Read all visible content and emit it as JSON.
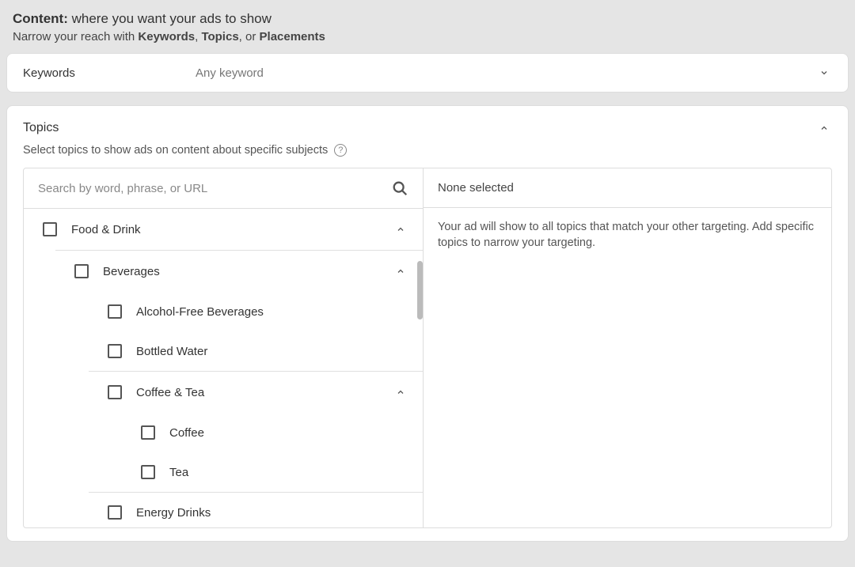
{
  "header": {
    "title_bold": "Content:",
    "title_rest": " where you want your ads to show",
    "subtitle_prefix": "Narrow your reach with ",
    "kw": "Keywords",
    "sep1": ", ",
    "topics": "Topics",
    "sep2": ", or ",
    "placements": "Placements"
  },
  "keywords": {
    "label": "Keywords",
    "value": "Any keyword"
  },
  "topics": {
    "title": "Topics",
    "subtitle": "Select topics to show ads on content about specific subjects",
    "search_placeholder": "Search by word, phrase, or URL",
    "none_selected": "None selected",
    "info_text": "Your ad will show to all topics that match your other targeting. Add specific topics to narrow your targeting.",
    "tree": {
      "item0": "Food & Drink",
      "item1": "Beverages",
      "item2": "Alcohol-Free Beverages",
      "item3": "Bottled Water",
      "item4": "Coffee & Tea",
      "item5": "Coffee",
      "item6": "Tea",
      "item7": "Energy Drinks"
    }
  }
}
